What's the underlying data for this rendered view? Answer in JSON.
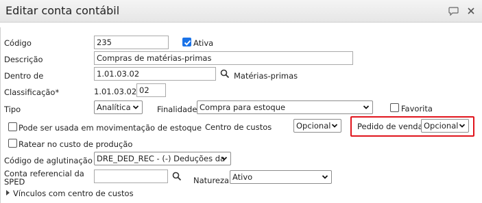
{
  "window": {
    "title": "Editar conta contábil",
    "icons": [
      "chat-bubble-icon",
      "close-icon"
    ]
  },
  "form": {
    "codigo": {
      "label": "Código",
      "value": "235"
    },
    "ativa": {
      "label": "Ativa",
      "checked": true
    },
    "descricao": {
      "label": "Descrição",
      "value": "Compras de matérias-primas"
    },
    "dentro_de": {
      "label": "Dentro de",
      "value": "1.01.03.02",
      "lookup_text": "Matérias-primas"
    },
    "classificacao": {
      "label": "Classificação*",
      "prefix": "1.01.03.02.",
      "value": "02"
    },
    "tipo": {
      "label": "Tipo",
      "value": "Analítica"
    },
    "finalidade": {
      "label": "Finalidade",
      "value": "Compra para estoque"
    },
    "favorita": {
      "label": "Favorita",
      "checked": false
    },
    "pode_ser_usada": {
      "label": "Pode ser usada em movimentação de estoque",
      "checked": false
    },
    "centro_custos": {
      "label": "Centro de custos",
      "value": "Opcional"
    },
    "pedido_venda": {
      "label": "Pedido de venda",
      "value": "Opcional"
    },
    "ratear": {
      "label": "Ratear no custo de produção",
      "checked": false
    },
    "codigo_aglutinacao": {
      "label": "Código de aglutinação",
      "value": "DRE_DED_REC - (-) Deduções da"
    },
    "conta_referencial": {
      "label_line1": "Conta referencial da",
      "label_line2": "SPED",
      "value": ""
    },
    "natureza": {
      "label": "Natureza",
      "value": "Ativo"
    },
    "vinculos": {
      "label": "Vínculos com centro de custos"
    }
  },
  "colors": {
    "highlight": "#e0141c",
    "checkbox_checked": "#1a73e8"
  }
}
